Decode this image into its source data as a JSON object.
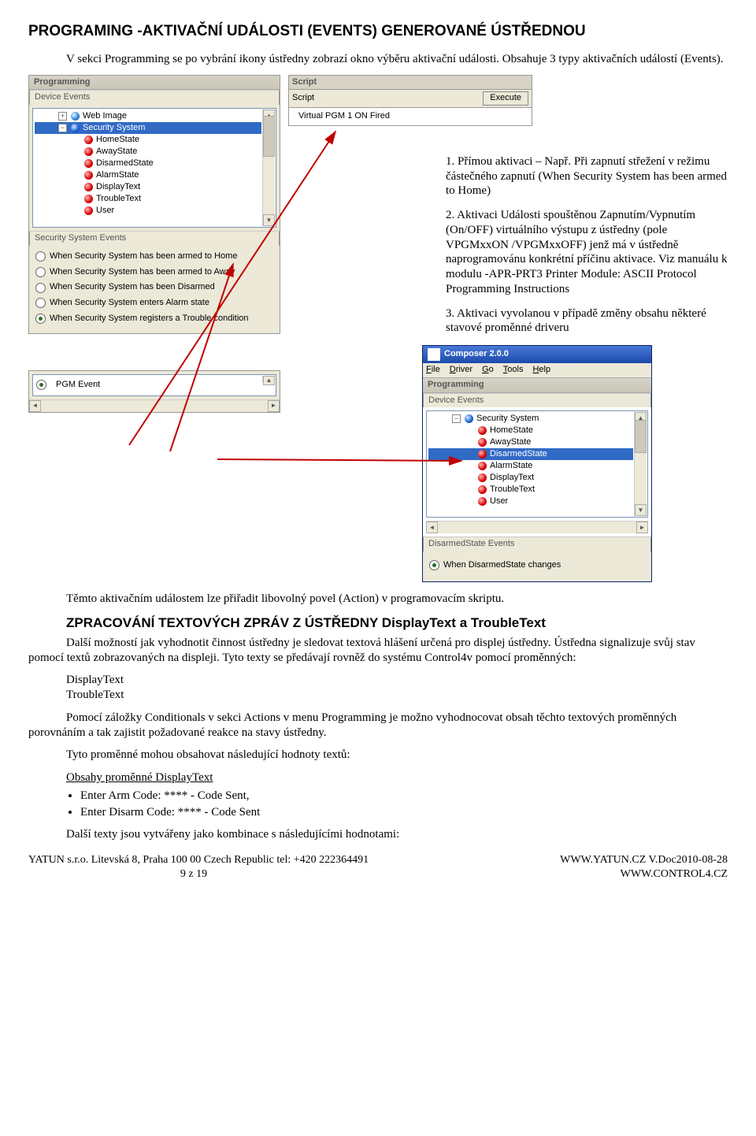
{
  "heading_main": "PROGRAMING -AKTIVAČNÍ UDÁLOSTI (EVENTS) GENEROVANÉ ÚSTŘEDNOU",
  "intro": "V sekci Programming se po vybrání ikony ústředny zobrazí okno výběru aktivační události. Obsahuje 3 typy aktivačních událostí (Events).",
  "numlist": {
    "i1": "1. Přímou aktivaci – Např. Při zapnutí střežení v režimu částečného zapnutí (When Security System has been armed to Home)",
    "i2": "2. Aktivaci Události spouštěnou Zapnutím/Vypnutím (On/OFF) virtuálního výstupu z ústředny (pole VPGMxxON /VPGMxxOFF) jenž má v ústředně naprogramovánu konkrétní příčinu aktivace. Viz manuálu k modulu -APR-PRT3 Printer Module: ASCII Protocol Programming Instructions",
    "i3": "3. Aktivaci vyvolanou v případě změny obsahu některé stavové proměnné driveru"
  },
  "prog_panel": {
    "title": "Programming",
    "section_label": "Device Events",
    "tree": {
      "webimage": "Web Image",
      "secsys": "Security System",
      "home": "HomeState",
      "away": "AwayState",
      "disarm": "DisarmedState",
      "alarm": "AlarmState",
      "disp": "DisplayText",
      "trouble": "TroubleText",
      "user": "User"
    },
    "events_label": "Security System Events",
    "radios": {
      "r1": "When Security System has been armed to Home",
      "r2": "When Security System has been armed to Away",
      "r3": "When Security System has been Disarmed",
      "r4": "When Security System enters Alarm state",
      "r5": "When Security System registers a Trouble condition"
    },
    "pgm_row": "PGM Event"
  },
  "script_panel": {
    "title": "Script",
    "sub": "Script",
    "exec": "Execute",
    "line": "Virtual PGM 1 ON Fired"
  },
  "composer": {
    "title": "Composer 2.0.0",
    "menu": {
      "file": "File",
      "driver": "Driver",
      "go": "Go",
      "tools": "Tools",
      "help": "Help"
    },
    "prog_title": "Programming",
    "section_label": "Device Events",
    "tree": {
      "secsys": "Security System",
      "home": "HomeState",
      "away": "AwayState",
      "disarm": "DisarmedState",
      "alarm": "AlarmState",
      "disp": "DisplayText",
      "trouble": "TroubleText",
      "user": "User"
    },
    "events_label": "DisarmedState Events",
    "radio": "When DisarmedState changes"
  },
  "body_text": {
    "p1": "Těmto aktivačním událostem lze přiřadit libovolný povel (Action) v programovacím skriptu.",
    "h2": "ZPRACOVÁNÍ TEXTOVÝCH ZPRÁV Z ÚSTŘEDNY DisplayText  a TroubleText",
    "p2": "Další možností jak vyhodnotit činnost ústředny je sledovat textová hlášení určená pro displej ústředny. Ústředna signalizuje svůj stav pomocí textů zobrazovaných na displeji. Tyto texty se předávají rovněž do systému Control4v  pomocí proměnných:",
    "v1": "DisplayText",
    "v2": "TroubleText",
    "p3": "Pomocí záložky Conditionals v sekci Actions v menu Programming je možno vyhodnocovat obsah těchto textových proměnných porovnáním a tak zajistit požadované reakce na stavy ústředny.",
    "p4": "Tyto proměnné mohou obsahovat následující hodnoty textů:",
    "p5": "Obsahy proměnné DisplayText",
    "b1": "Enter Arm Code: **** - Code Sent,",
    "b2": "Enter Disarm Code: **** - Code Sent",
    "p6": "Další texty jsou vytvářeny jako kombinace s následujícími hodnotami:"
  },
  "footer": {
    "left1": "YATUN s.r.o.    Litevská 8,    Praha    100 00 Czech Republic  tel: +420  222364491",
    "left2": "9 z 19",
    "right1": "WWW.YATUN.CZ V.Doc2010-08-28",
    "right2": "WWW.CONTROL4.CZ"
  }
}
